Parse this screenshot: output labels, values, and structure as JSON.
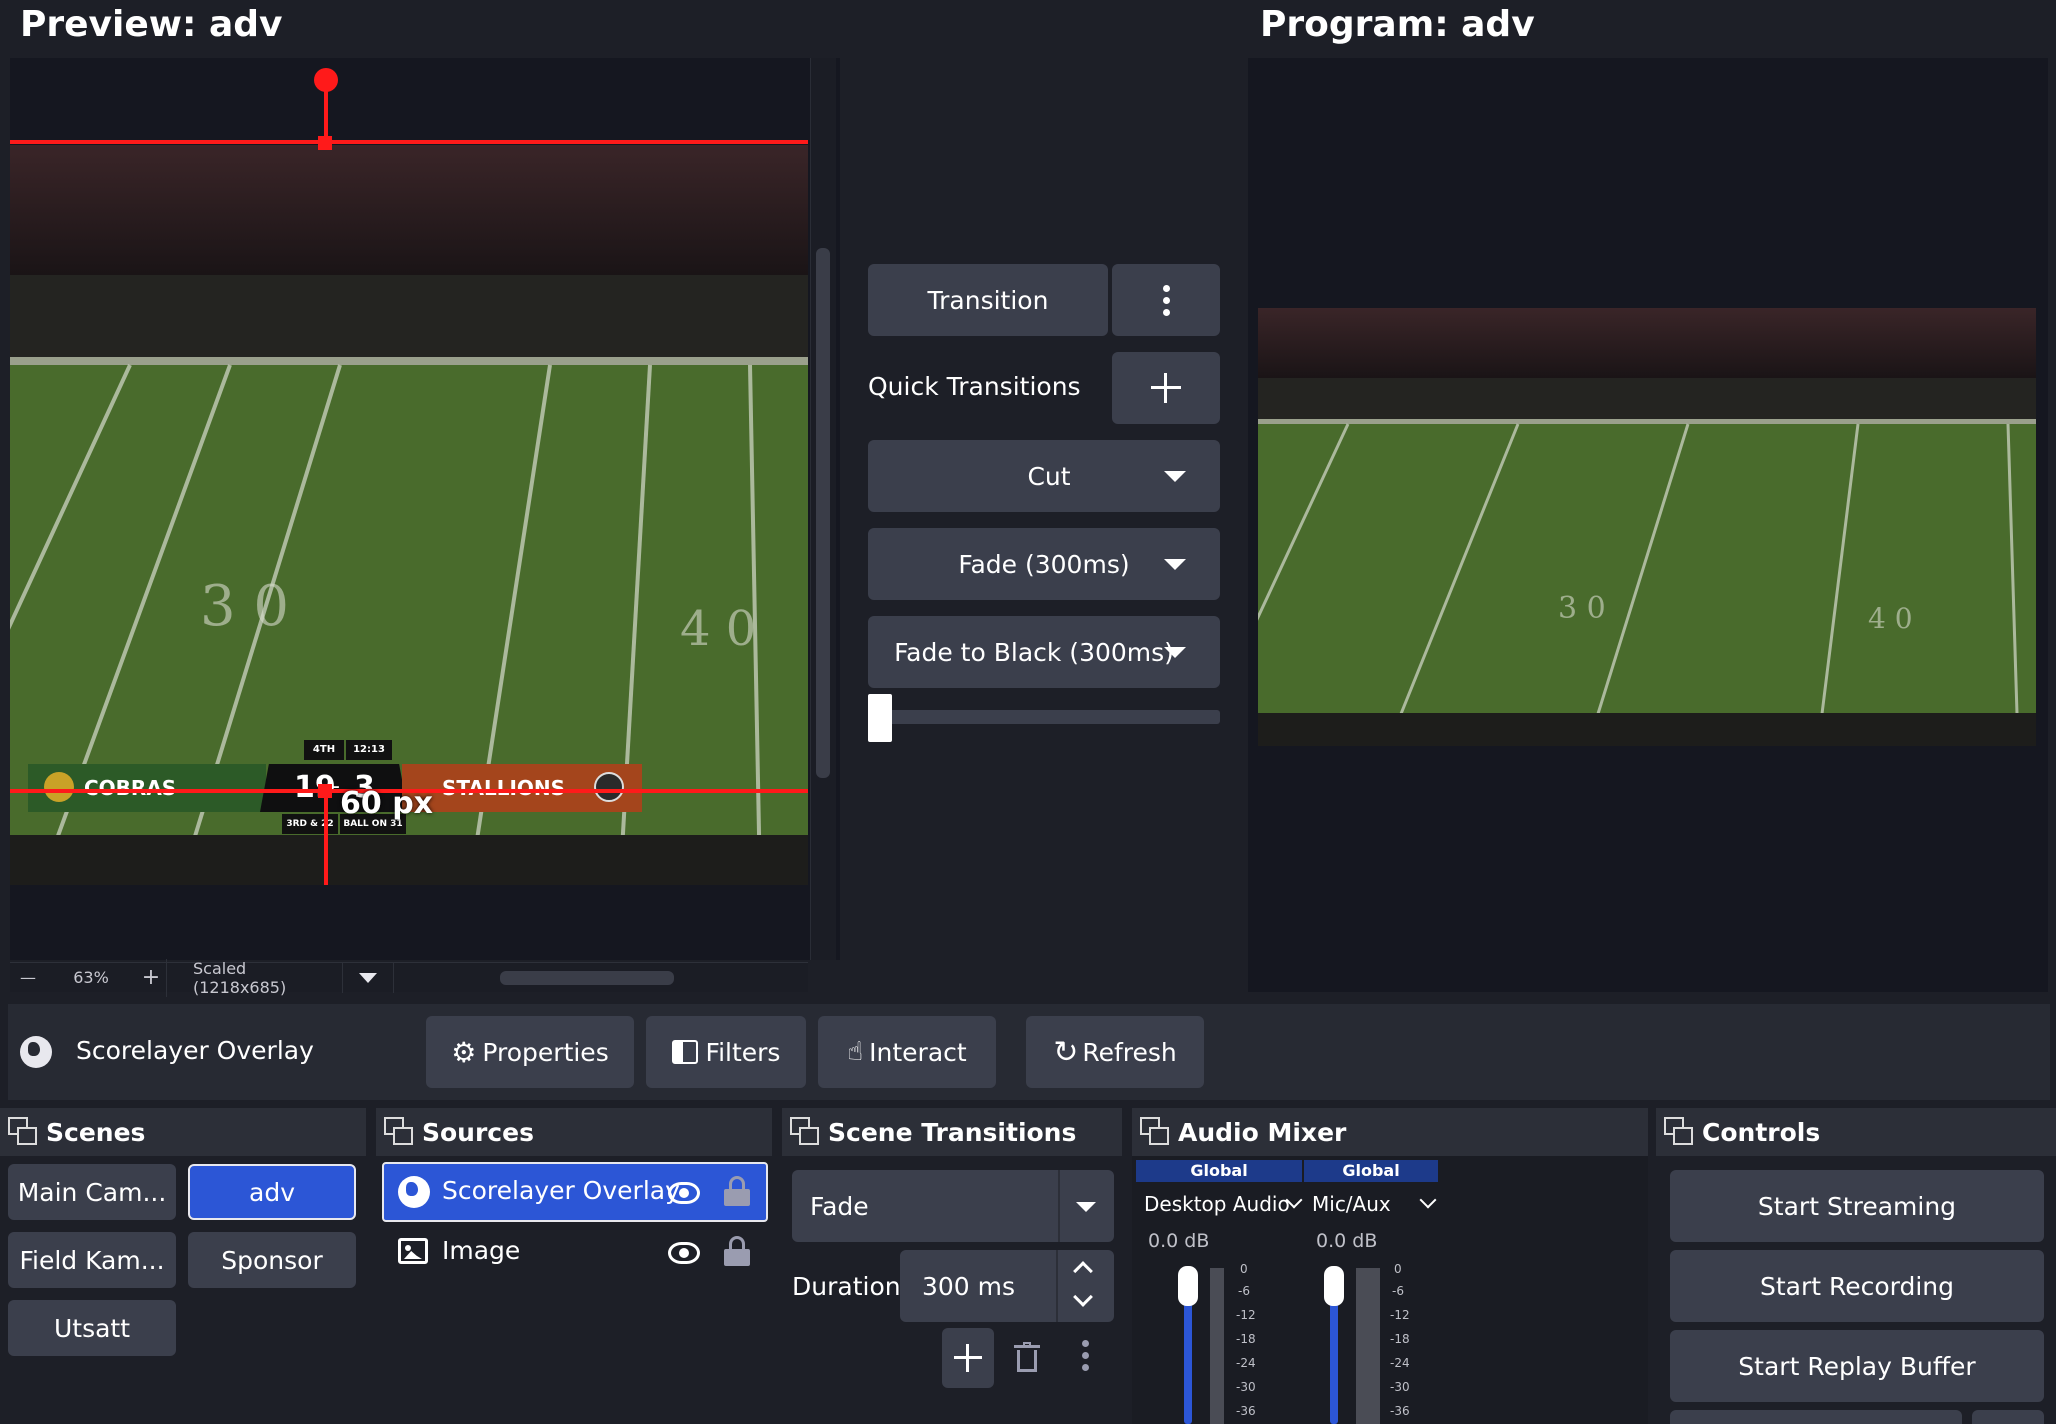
{
  "preview": {
    "title": "Preview: adv",
    "measure_label": "60 px",
    "zoom_minus": "—",
    "zoom": "63%",
    "zoom_plus": "+",
    "scale_mode": "Scaled (1218x685)"
  },
  "program": {
    "title": "Program: adv"
  },
  "scoreboard": {
    "period": "4TH",
    "clock": "12:13",
    "home_team": "COBRAS",
    "away_team": "STALLIONS",
    "home_score": "19",
    "dash": "-",
    "away_score": "3",
    "down": "3RD & 22",
    "ball_on": "BALL ON 31",
    "home_logo_text": "COBRAS",
    "away_logo_text": "STALLIONS"
  },
  "transitions_center": {
    "transition_label": "Transition",
    "quick_transitions_label": "Quick Transitions",
    "quick_items": [
      "Cut",
      "Fade (300ms)",
      "Fade to Black (300ms)"
    ],
    "tbar_position": 0.0
  },
  "source_toolbar": {
    "source_name": "Scorelayer Overlay",
    "properties": "Properties",
    "filters": "Filters",
    "interact": "Interact",
    "refresh": "Refresh"
  },
  "scenes": {
    "title": "Scenes",
    "items": [
      "Main Cam...",
      "adv",
      "Field Kam...",
      "Sponsor",
      "Utsatt"
    ],
    "active": "adv"
  },
  "sources": {
    "title": "Sources",
    "items": [
      {
        "name": "Scorelayer Overlay",
        "icon": "globe-icon",
        "selected": true
      },
      {
        "name": "Image",
        "icon": "image-icon",
        "selected": false
      }
    ]
  },
  "scene_transitions": {
    "title": "Scene Transitions",
    "selected": "Fade",
    "duration_label": "Duration",
    "duration_value": "300 ms"
  },
  "audio_mixer": {
    "title": "Audio Mixer",
    "channels": [
      {
        "badge": "Global",
        "name": "Desktop Audio",
        "db": "0.0 dB"
      },
      {
        "badge": "Global",
        "name": "Mic/Aux",
        "db": "0.0 dB"
      }
    ],
    "scale": [
      "0",
      "-6",
      "-12",
      "-18",
      "-24",
      "-30",
      "-36"
    ]
  },
  "controls": {
    "title": "Controls",
    "start_streaming": "Start Streaming",
    "start_recording": "Start Recording",
    "start_replay_buffer": "Start Replay Buffer"
  },
  "colors": {
    "accent": "#2c56d6",
    "guide_red": "#ff1a1a",
    "home_green": "#2c5a27",
    "away_orange": "#a4451c"
  }
}
